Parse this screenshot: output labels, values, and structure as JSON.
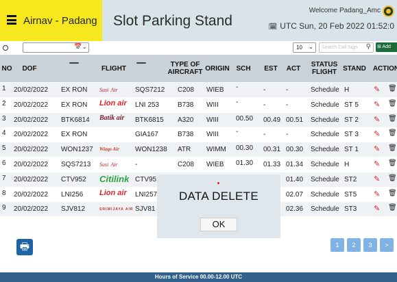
{
  "header": {
    "app_name": "Airnav - Padang",
    "title": "Slot Parking Stand",
    "welcome": "Welcome Padang_Amc",
    "datetime": "UTC Sun, 20 Feb 2022 01:52:0"
  },
  "filter": {
    "page_size": "10",
    "search_placeholder": "Search Call Sign",
    "add_label": "Add"
  },
  "table": {
    "headers": [
      "NO",
      "DOF",
      "",
      "FLIGHT",
      "",
      "TYPE OF AIRCRAFT",
      "ORIGIN",
      "SCH",
      "EST",
      "ACT",
      "STATUS FLIGHT",
      "STAND",
      "ACTION"
    ],
    "rows": [
      {
        "no": "1",
        "dof": "20/02/2022",
        "arr": "EX RON",
        "logo": "Susi Air",
        "dep": "SQS7212",
        "type": "C208",
        "origin": "WIEB",
        "sch": "-",
        "est": "-",
        "act": "-",
        "status": "Schedule",
        "stand": "H"
      },
      {
        "no": "2",
        "dof": "20/02/2022",
        "arr": "EX RON",
        "logo": "Lion Air",
        "dep": "LNI 253",
        "type": "B738",
        "origin": "WIII",
        "sch": "-",
        "est": "-",
        "act": "-",
        "status": "Schedule",
        "stand": "ST 5"
      },
      {
        "no": "3",
        "dof": "20/02/2022",
        "arr": "BTK6814",
        "logo": "Batik Air",
        "dep": "BTK6815",
        "type": "A320",
        "origin": "WIII",
        "sch": "00.50",
        "est": "00.49",
        "act": "00.51",
        "status": "Schedule",
        "stand": "ST 2"
      },
      {
        "no": "4",
        "dof": "20/02/2022",
        "arr": "EX RON",
        "logo": "",
        "dep": "GIA167",
        "type": "B738",
        "origin": "WIII",
        "sch": "-",
        "est": "-",
        "act": "-",
        "status": "Schedule",
        "stand": "ST 3"
      },
      {
        "no": "5",
        "dof": "20/02/2022",
        "arr": "WON1237",
        "logo": "Wings Air",
        "dep": "WON1238",
        "type": "ATR",
        "origin": "WIMM",
        "sch": "00.30",
        "est": "00.31",
        "act": "00.30",
        "status": "Schedule",
        "stand": "ST 1"
      },
      {
        "no": "6",
        "dof": "20/02/2022",
        "arr": "SQS7213",
        "logo": "Susi Air",
        "dep": "-",
        "type": "C208",
        "origin": "WIEB",
        "sch": "01.30",
        "est": "01.33",
        "act": "01.34",
        "status": "Schedule",
        "stand": "H"
      },
      {
        "no": "7",
        "dof": "20/02/2022",
        "arr": "CTV952",
        "logo": "Citilink",
        "dep": "CTV95",
        "type": "",
        "origin": "",
        "sch": "",
        "est": "",
        "act": "01.40",
        "status": "Schedule",
        "stand": "ST2"
      },
      {
        "no": "8",
        "dof": "20/02/2022",
        "arr": "LNI256",
        "logo": "Lion Air",
        "dep": "LNI257",
        "type": "",
        "origin": "",
        "sch": "",
        "est": "",
        "act": "02.07",
        "status": "Schedule",
        "stand": "ST5"
      },
      {
        "no": "9",
        "dof": "20/02/2022",
        "arr": "SJV812",
        "logo": "Sriwijaya Air",
        "dep": "SJV81",
        "type": "",
        "origin": "",
        "sch": "",
        "est": "",
        "act": "02.36",
        "status": "Schedule",
        "stand": "ST3"
      }
    ]
  },
  "logos": {
    "Susi Air": {
      "main": "Susi",
      "sub": "Air"
    },
    "Lion Air": {
      "main": "Lion",
      "sub": "air"
    },
    "Batik Air": {
      "main": "Batik air",
      "sub": ""
    },
    "Wings Air": {
      "main": "Wings Air",
      "sub": ""
    },
    "Citilink": {
      "main": "Citilink",
      "sub": ""
    },
    "Sriwijaya Air": {
      "main": "SRIWIJAYA AIR",
      "sub": ""
    }
  },
  "pagination": {
    "pages": [
      "1",
      "2",
      "3"
    ],
    "next": ">"
  },
  "footer": {
    "text": "Hours of Service 00.00-12.00 UTC"
  },
  "modal": {
    "message": "DATA DELETE",
    "ok_label": "OK"
  },
  "icons": {
    "menu": "hamburger-menu-icon",
    "avatar": "user-avatar-icon",
    "clock": "calendar-icon",
    "arrival": "plane-landing-icon",
    "departure": "plane-takeoff-icon",
    "edit": "edit-icon",
    "delete": "trash-icon",
    "print": "print-icon",
    "search": "search-icon"
  },
  "colors": {
    "header_left": "#f7e81e",
    "header": "#d9e3ea",
    "footer": "#33618d",
    "add_button": "#1d6b3b",
    "print_button": "#1d64a5",
    "pager": "#7fb3e4"
  }
}
